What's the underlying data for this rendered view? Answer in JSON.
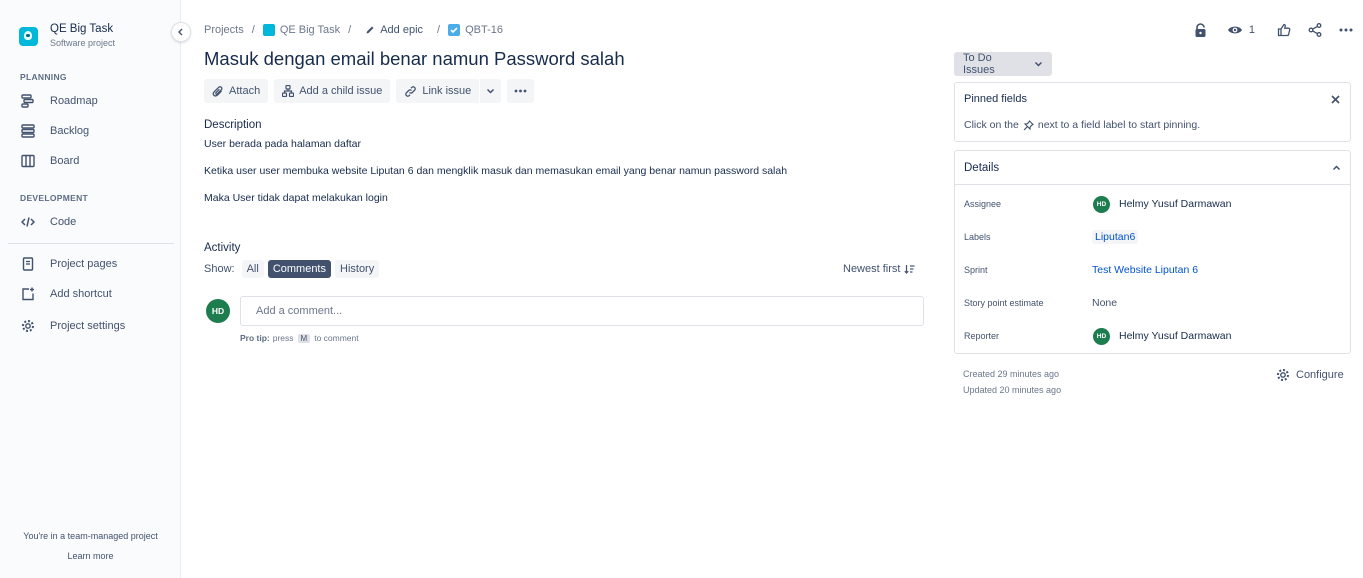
{
  "sidebar": {
    "project_name": "QE Big Task",
    "project_type": "Software project",
    "planning_title": "PLANNING",
    "planning_items": [
      {
        "label": "Roadmap",
        "icon": "roadmap-icon"
      },
      {
        "label": "Backlog",
        "icon": "backlog-icon"
      },
      {
        "label": "Board",
        "icon": "board-icon"
      }
    ],
    "development_title": "DEVELOPMENT",
    "development_items": [
      {
        "label": "Code",
        "icon": "code-icon"
      }
    ],
    "other_items": [
      {
        "label": "Project pages",
        "icon": "pages-icon"
      },
      {
        "label": "Add shortcut",
        "icon": "add-shortcut-icon"
      },
      {
        "label": "Project settings",
        "icon": "settings-icon"
      }
    ],
    "team_note": "You're in a team-managed project",
    "learn_more": "Learn more"
  },
  "breadcrumb": {
    "projects": "Projects",
    "project": "QE Big Task",
    "epic": "Add epic",
    "issue_key": "QBT-16",
    "separator": "/"
  },
  "top_actions": {
    "watchers_count": "1"
  },
  "issue": {
    "title": "Masuk dengan email benar namun Password salah",
    "toolbar": {
      "attach": "Attach",
      "add_child": "Add a child issue",
      "link_issue": "Link issue"
    },
    "description_label": "Description",
    "description_lines": [
      "User berada pada halaman daftar",
      "Ketika user user membuka website Liputan 6 dan mengklik masuk dan memasukan email yang benar namun password salah",
      "Maka User tidak dapat melakukan login"
    ]
  },
  "activity": {
    "label": "Activity",
    "show_label": "Show:",
    "filters": [
      "All",
      "Comments",
      "History"
    ],
    "active_filter": "Comments",
    "sort": "Newest first",
    "user_initials": "HD",
    "comment_placeholder": "Add a comment...",
    "pro_tip_label": "Pro tip:",
    "pro_tip_press": "press",
    "pro_tip_key": "M",
    "pro_tip_suffix": "to comment"
  },
  "right_panel": {
    "status": "To Do Issues",
    "pinned_title": "Pinned fields",
    "pinned_hint_before": "Click on the",
    "pinned_hint_after": "next to a field label to start pinning.",
    "details_title": "Details",
    "fields": {
      "assignee_label": "Assignee",
      "assignee": "Helmy Yusuf Darmawan",
      "assignee_initials": "HD",
      "labels_label": "Labels",
      "labels": "Liputan6",
      "sprint_label": "Sprint",
      "sprint": "Test Website Liputan 6",
      "story_points_label": "Story point estimate",
      "story_points": "None",
      "reporter_label": "Reporter",
      "reporter": "Helmy Yusuf Darmawan",
      "reporter_initials": "HD"
    },
    "created": "Created 29 minutes ago",
    "updated": "Updated 20 minutes ago",
    "configure": "Configure"
  },
  "colors": {
    "avatar_green": "#1d7d4f",
    "link_blue": "#0052cc",
    "project_icon": "#00b8d9"
  }
}
